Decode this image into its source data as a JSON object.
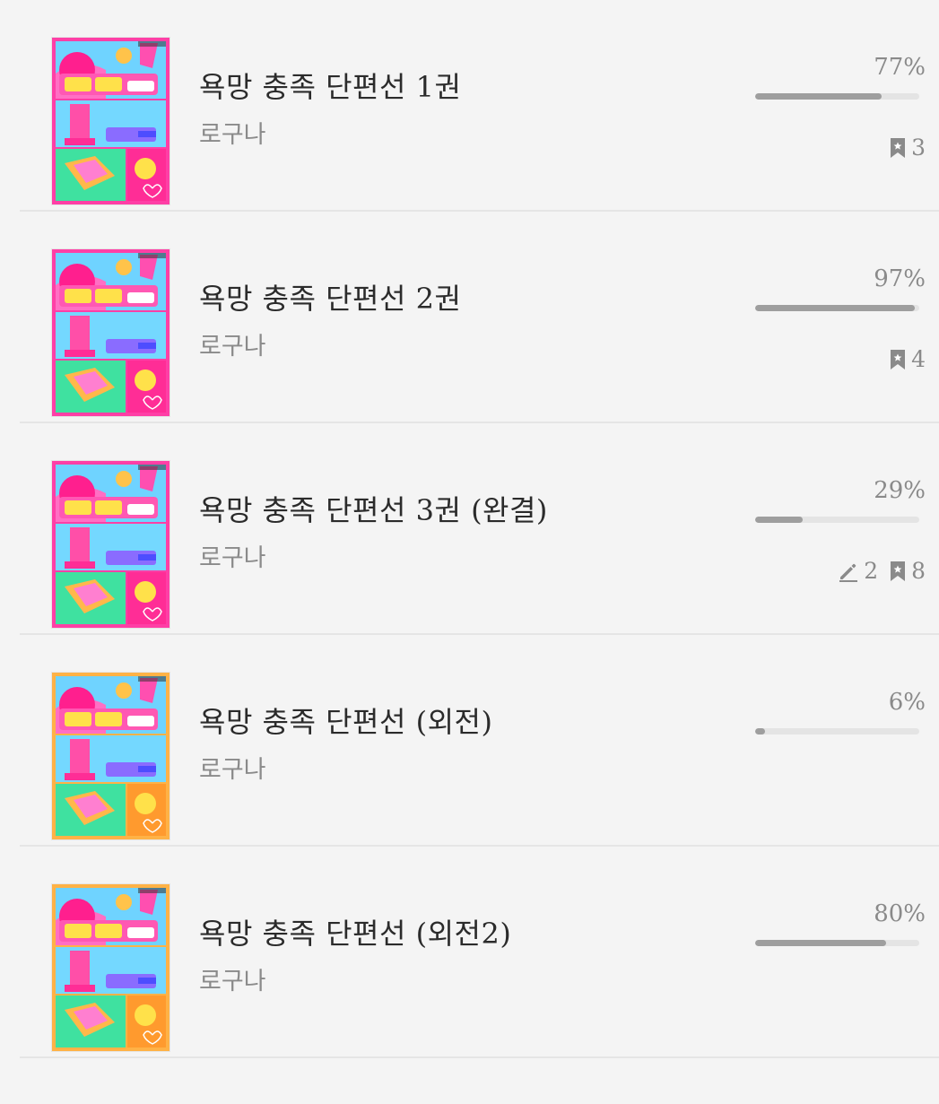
{
  "books": [
    {
      "title": "욕망 충족 단편선 1권",
      "author": "로구나",
      "percent_label": "77%",
      "progress": 0.77,
      "memos": null,
      "bookmarks": "3",
      "cover_variant": "pink"
    },
    {
      "title": "욕망 충족 단편선 2권",
      "author": "로구나",
      "percent_label": "97%",
      "progress": 0.97,
      "memos": null,
      "bookmarks": "4",
      "cover_variant": "pink"
    },
    {
      "title": "욕망 충족 단편선 3권 (완결)",
      "author": "로구나",
      "percent_label": "29%",
      "progress": 0.29,
      "memos": "2",
      "bookmarks": "8",
      "cover_variant": "pink"
    },
    {
      "title": "욕망 충족 단편선 (외전)",
      "author": "로구나",
      "percent_label": "6%",
      "progress": 0.06,
      "memos": null,
      "bookmarks": null,
      "cover_variant": "orange"
    },
    {
      "title": "욕망 충족 단편선 (외전2)",
      "author": "로구나",
      "percent_label": "80%",
      "progress": 0.8,
      "memos": null,
      "bookmarks": null,
      "cover_variant": "orange"
    }
  ],
  "icons": {
    "bookmark": "bookmark-icon",
    "memo": "pencil-icon"
  },
  "colors": {
    "background": "#f4f4f4",
    "progress_fill": "#9e9e9e",
    "progress_track": "#e4e4e4",
    "title": "#2b2b2b",
    "secondary": "#8a8a8a",
    "cover_pink_frame": "#ff3fa6",
    "cover_orange_frame": "#ffb246",
    "cover_blue": "#6fd3ff",
    "cover_green": "#3fe1a0"
  }
}
